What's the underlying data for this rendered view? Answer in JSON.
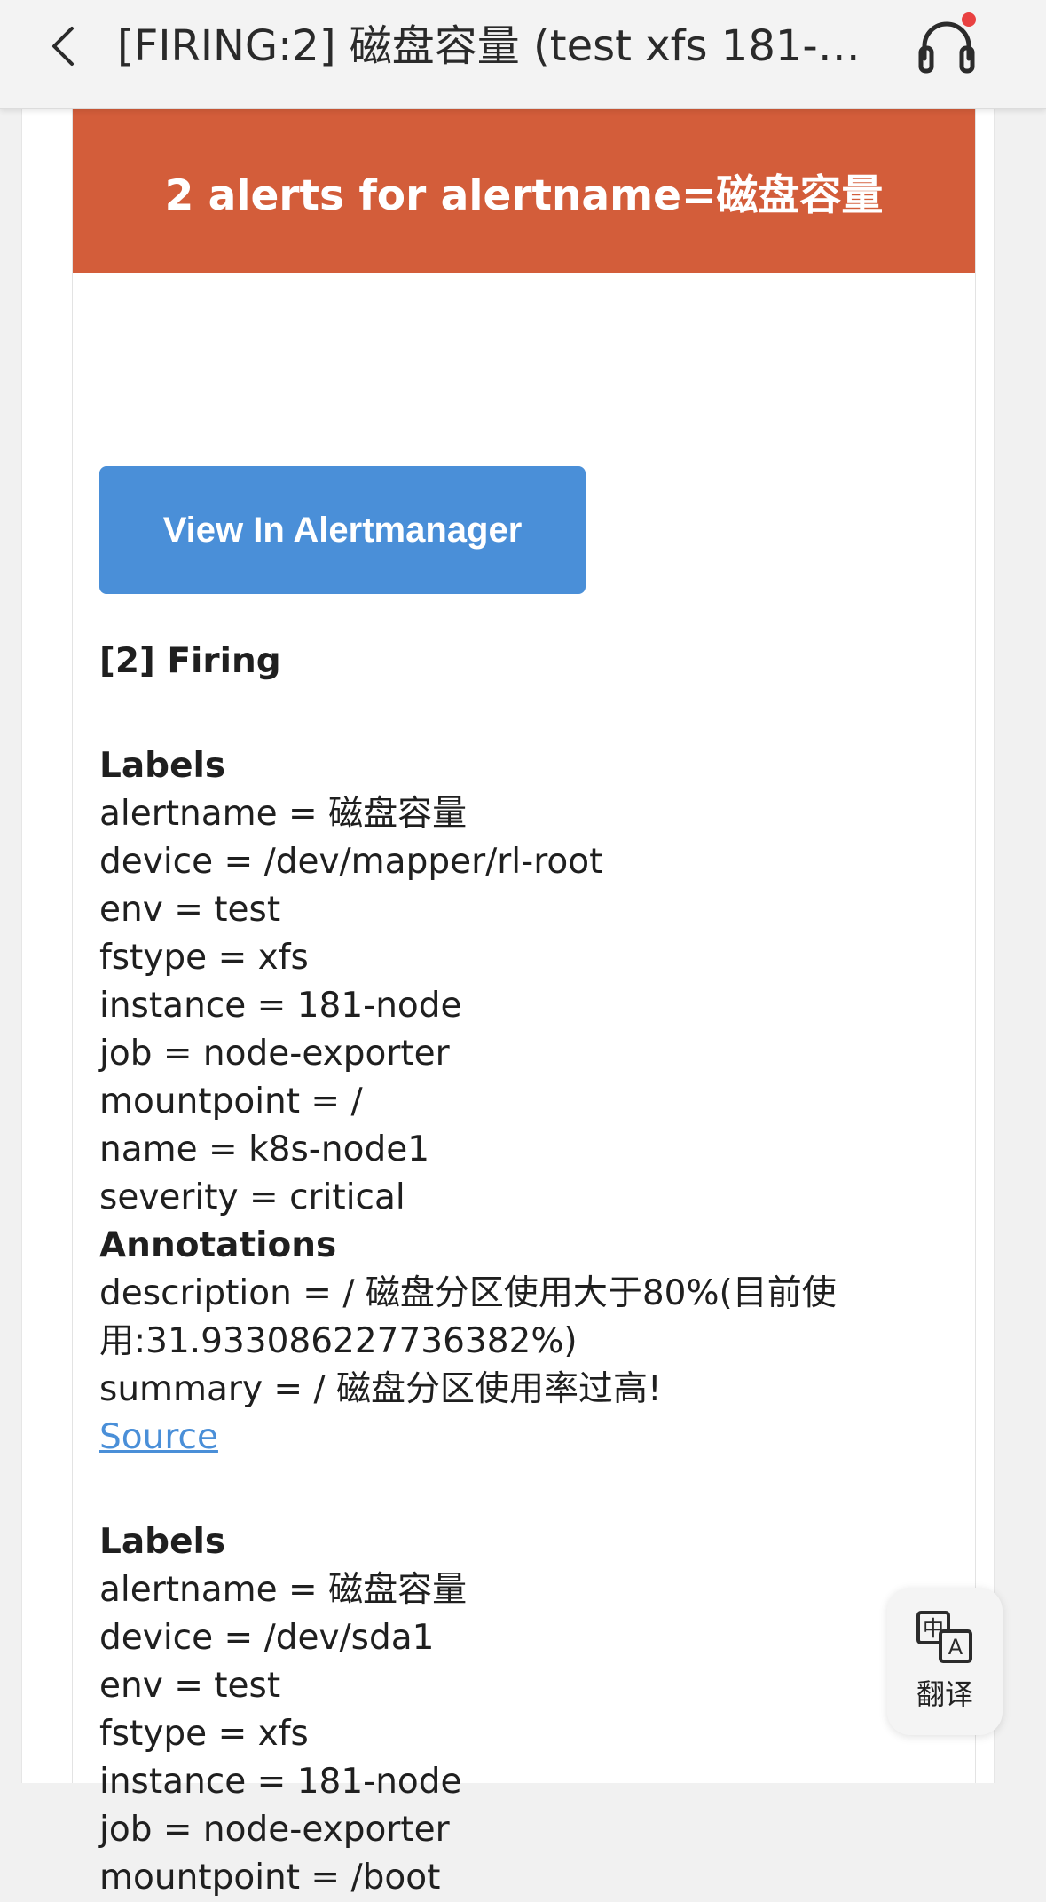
{
  "nav": {
    "title": "[FIRING:2] 磁盘容量 (test xfs 181-no...",
    "back_icon": "chevron-left-icon",
    "headset_icon": "headset-icon"
  },
  "alert_header": {
    "text": "2 alerts for alertname=磁盘容量",
    "color": "#d35d3a"
  },
  "view_button": {
    "label": "View In Alertmanager",
    "color": "#4a8fd8"
  },
  "firing_heading": "[2] Firing",
  "alerts": [
    {
      "labels_heading": "Labels",
      "labels": [
        "alertname = 磁盘容量",
        "device = /dev/mapper/rl-root",
        "env = test",
        "fstype = xfs",
        "instance = 181-node",
        "job = node-exporter",
        "mountpoint = /",
        "name = k8s-node1",
        "severity = critical"
      ],
      "annotations_heading": "Annotations",
      "annotations": [
        "description = / 磁盘分区使用大于80%(目前使用:31.933086227736382%)",
        "summary = / 磁盘分区使用率过高!"
      ],
      "source_link": "Source"
    },
    {
      "labels_heading": "Labels",
      "labels": [
        "alertname = 磁盘容量",
        "device = /dev/sda1",
        "env = test",
        "fstype = xfs",
        "instance = 181-node",
        "job = node-exporter",
        "mountpoint = /boot"
      ]
    }
  ],
  "translate_button": {
    "label": "翻译",
    "icon": "translate-icon"
  }
}
